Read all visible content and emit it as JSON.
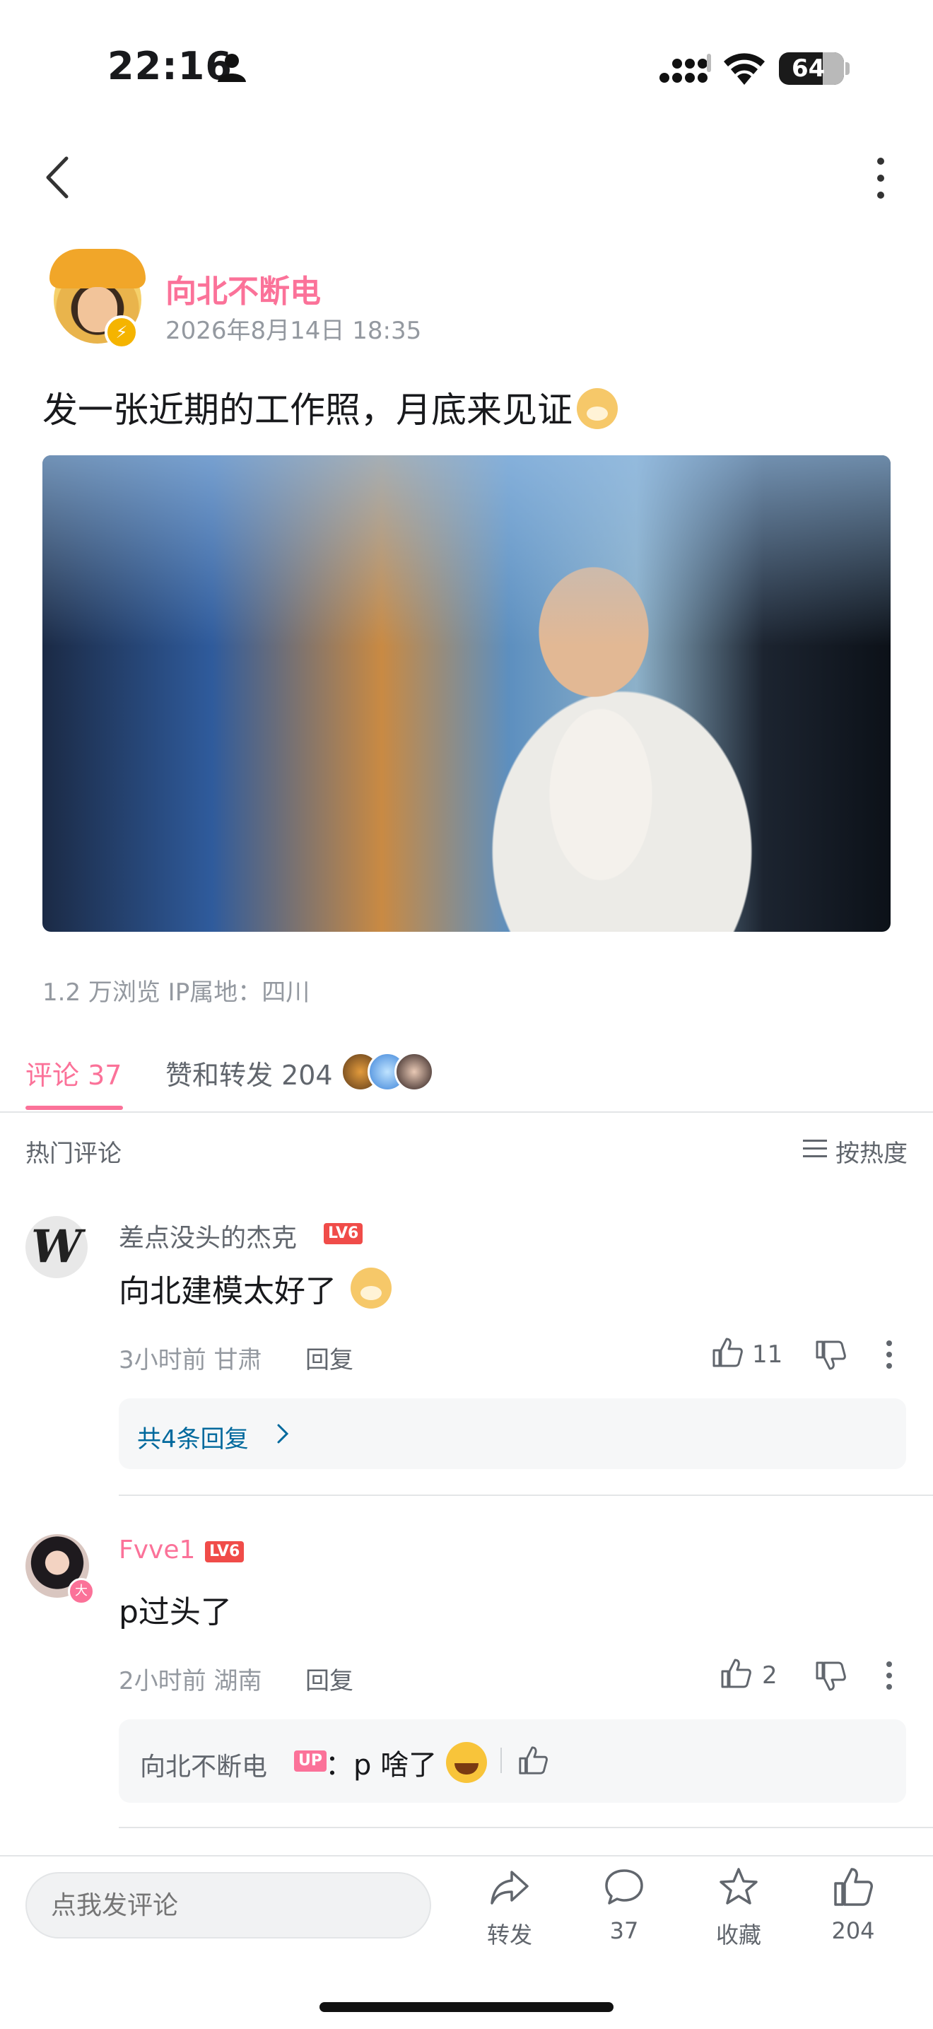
{
  "status_bar": {
    "time": "22:16",
    "battery": "64"
  },
  "post": {
    "author": "向北不断电",
    "date": "2026年8月14日 18:35",
    "text": "发一张近期的工作照，月底来见证",
    "stats": "1.2 万浏览  IP属地：四川"
  },
  "tabs": {
    "comments": "评论 37",
    "likes": "赞和转发 204"
  },
  "section": {
    "hot_label": "热门评论",
    "sort_label": "按热度"
  },
  "comments": [
    {
      "author": "差点没头的杰克",
      "level": "LV6",
      "text": "向北建模太好了",
      "meta": "3小时前  甘肃",
      "reply_label": "回复",
      "likes": "11",
      "replies_link": "共4条回复",
      "avatar_letter": "W"
    },
    {
      "author": "Fvve1",
      "level": "LV6",
      "text": "p过头了",
      "meta": "2小时前  湖南",
      "reply_label": "回复",
      "likes": "2",
      "sub_reply": {
        "author": "向北不断电",
        "badge": "UP",
        "text": "：p 啥了"
      }
    }
  ],
  "bottom_bar": {
    "input_placeholder": "点我发评论",
    "share_label": "转发",
    "comment_count": "37",
    "favorite_label": "收藏",
    "like_count": "204"
  },
  "colors": {
    "accent": "#fb7299",
    "link": "#00699d",
    "level": "#f04c49"
  }
}
